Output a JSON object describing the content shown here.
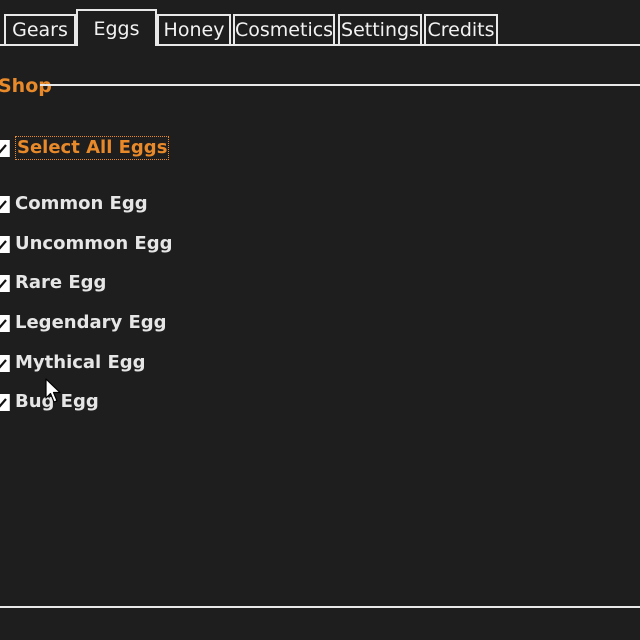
{
  "tabs": [
    {
      "label": "Gears",
      "active": false
    },
    {
      "label": "Eggs",
      "active": true
    },
    {
      "label": "Honey",
      "active": false
    },
    {
      "label": "Cosmetics",
      "active": false
    },
    {
      "label": "Settings",
      "active": false
    },
    {
      "label": "Credits",
      "active": false
    }
  ],
  "group": {
    "title": "Shop"
  },
  "select_all": {
    "label": "Select All Eggs",
    "checked": true
  },
  "eggs": [
    {
      "label": "Common Egg",
      "checked": true
    },
    {
      "label": "Uncommon Egg",
      "checked": true
    },
    {
      "label": "Rare Egg",
      "checked": true
    },
    {
      "label": "Legendary Egg",
      "checked": true
    },
    {
      "label": "Mythical Egg",
      "checked": true
    },
    {
      "label": "Bug Egg",
      "checked": true
    }
  ],
  "colors": {
    "background": "#1e1e1e",
    "accent": "#e8892a",
    "text": "#e6e6e6",
    "border": "#e8e8e8"
  }
}
